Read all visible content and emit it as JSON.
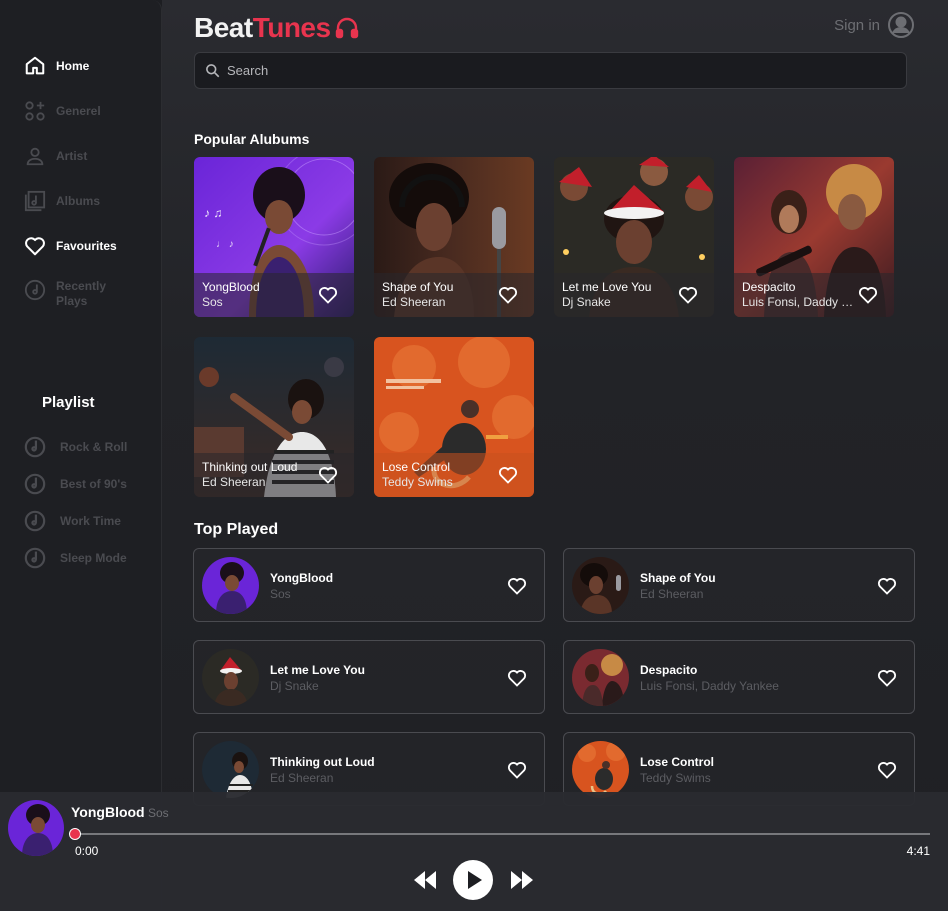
{
  "brand": {
    "part1": "Beat",
    "part2": "Tunes",
    "accent": "#e8344e"
  },
  "header": {
    "sign_in": "Sign in"
  },
  "search": {
    "placeholder": "Search"
  },
  "sidebar": {
    "items": [
      {
        "label": "Home",
        "icon": "home-icon",
        "active": true
      },
      {
        "label": "Generel",
        "icon": "genre-icon",
        "active": false
      },
      {
        "label": "Artist",
        "icon": "user-icon",
        "active": false
      },
      {
        "label": "Albums",
        "icon": "album-icon",
        "active": false
      },
      {
        "label": "Favourites",
        "icon": "heart-icon",
        "active": true
      },
      {
        "label": "Recently\nPlays",
        "icon": "recent-icon",
        "active": false
      }
    ],
    "playlist_title": "Playlist",
    "playlists": [
      {
        "label": "Rock & Roll",
        "icon": "disc-icon"
      },
      {
        "label": "Best of 90's",
        "icon": "disc-icon"
      },
      {
        "label": "Work Time",
        "icon": "disc-icon"
      },
      {
        "label": "Sleep Mode",
        "icon": "disc-icon"
      }
    ]
  },
  "popular": {
    "title": "Popular Alubums",
    "albums": [
      {
        "title": "YongBlood",
        "artist": "Sos"
      },
      {
        "title": "Shape of You",
        "artist": "Ed Sheeran"
      },
      {
        "title": "Let me Love You",
        "artist": "Dj Snake"
      },
      {
        "title": "Despacito",
        "artist": "Luis Fonsi, Daddy Yankee"
      },
      {
        "title": "Thinking out Loud",
        "artist": "Ed Sheeran"
      },
      {
        "title": "Lose Control",
        "artist": "Teddy Swims"
      }
    ]
  },
  "top_played": {
    "title": "Top Played",
    "tracks": [
      {
        "title": "YongBlood",
        "artist": "Sos"
      },
      {
        "title": "Shape of You",
        "artist": "Ed Sheeran"
      },
      {
        "title": "Let me Love You",
        "artist": "Dj Snake"
      },
      {
        "title": "Despacito",
        "artist": "Luis Fonsi, Daddy Yankee"
      },
      {
        "title": "Thinking out Loud",
        "artist": "Ed Sheeran"
      },
      {
        "title": "Lose Control",
        "artist": "Teddy Swims"
      }
    ]
  },
  "player": {
    "title": "YongBlood",
    "artist": "Sos",
    "current_time": "0:00",
    "duration": "4:41",
    "progress": 0
  }
}
